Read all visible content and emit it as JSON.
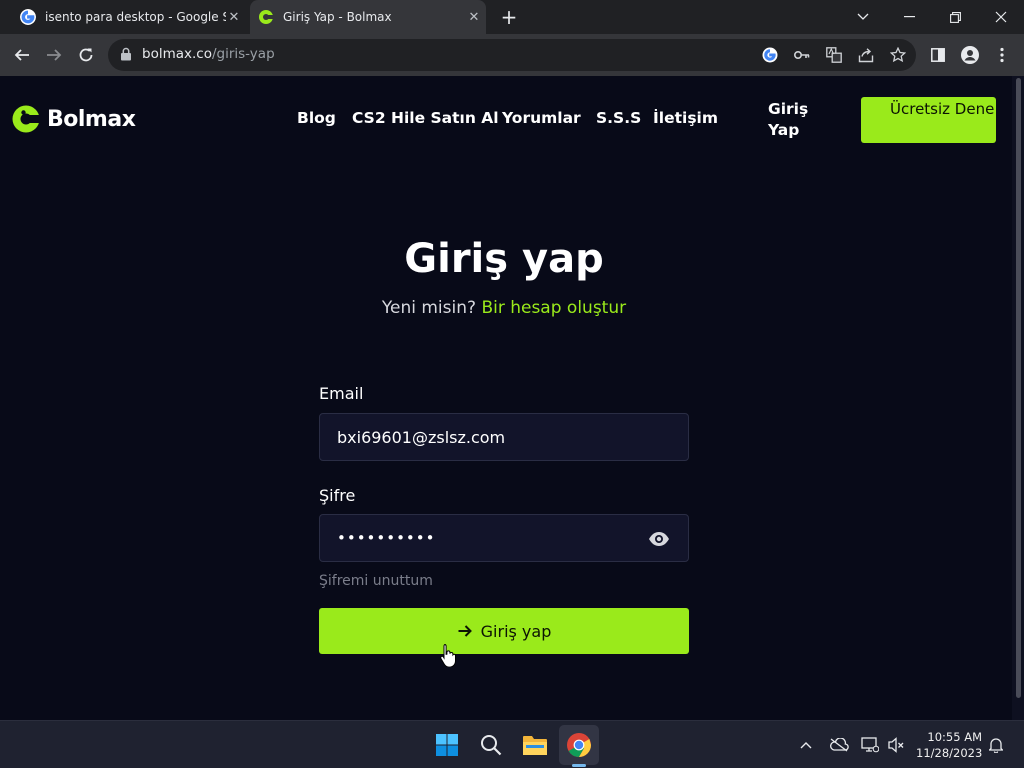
{
  "browser": {
    "tabs": [
      {
        "title": "isento para desktop - Google Se",
        "active": false
      },
      {
        "title": "Giriş Yap - Bolmax",
        "active": true
      }
    ],
    "new_tab_label": "+",
    "url_host": "bolmax.co",
    "url_path": "/giris-yap"
  },
  "site": {
    "logo_text": "Bolmax",
    "brand_color": "#9aea1b",
    "nav": [
      "Blog",
      "CS2 Hile Satın Al",
      "Yorumlar",
      "S.S.S",
      "İletişim"
    ],
    "login_label": "Giriş Yap",
    "trial_label": "Ücretsiz Dene"
  },
  "form": {
    "heading": "Giriş yap",
    "subtitle_prefix": "Yeni misin?",
    "subtitle_link": "Bir hesap oluştur",
    "email_label": "Email",
    "email_value": "bxi69601@zslsz.com",
    "password_label": "Şifre",
    "password_mask": "••••••••••",
    "forgot_label": "Şifremi unuttum",
    "submit_label": "Giriş yap"
  },
  "taskbar": {
    "time": "10:55 AM",
    "date": "11/28/2023"
  }
}
